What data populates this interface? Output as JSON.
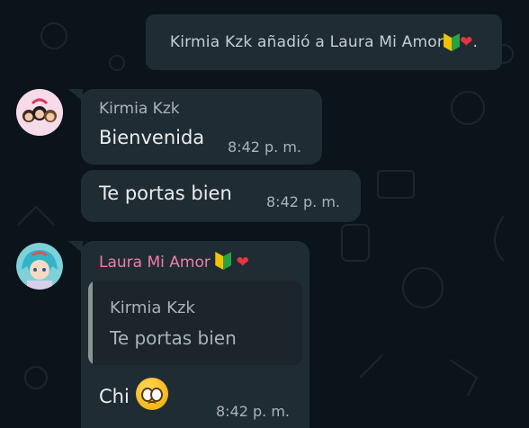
{
  "colors": {
    "background": "#0b141a",
    "bubble": "#202c33",
    "sender_kirmia": "#aab3b8",
    "sender_laura": "#f07da8",
    "timestamp": "#aab3b8"
  },
  "system_message": {
    "text": "Kirmia Kzk añadió a Laura Mi Amor",
    "suffix": ".",
    "emoji": [
      "beginner-badge-icon",
      "red-heart-icon"
    ]
  },
  "messages": [
    {
      "sender": "Kirmia Kzk",
      "text": "Bienvenida",
      "time": "8:42 p. m.",
      "avatar": "group-avatar-icon"
    },
    {
      "text": "Te portas bien",
      "time": "8:42 p. m."
    },
    {
      "sender": "Laura Mi Amor",
      "sender_emoji": [
        "beginner-badge-icon",
        "red-heart-icon"
      ],
      "avatar": "anime-girl-avatar-icon",
      "quoted": {
        "sender": "Kirmia Kzk",
        "text": "Te portas bien"
      },
      "text": "Chi",
      "text_emoji": "pleading-face-icon",
      "time": "8:42 p. m."
    }
  ]
}
